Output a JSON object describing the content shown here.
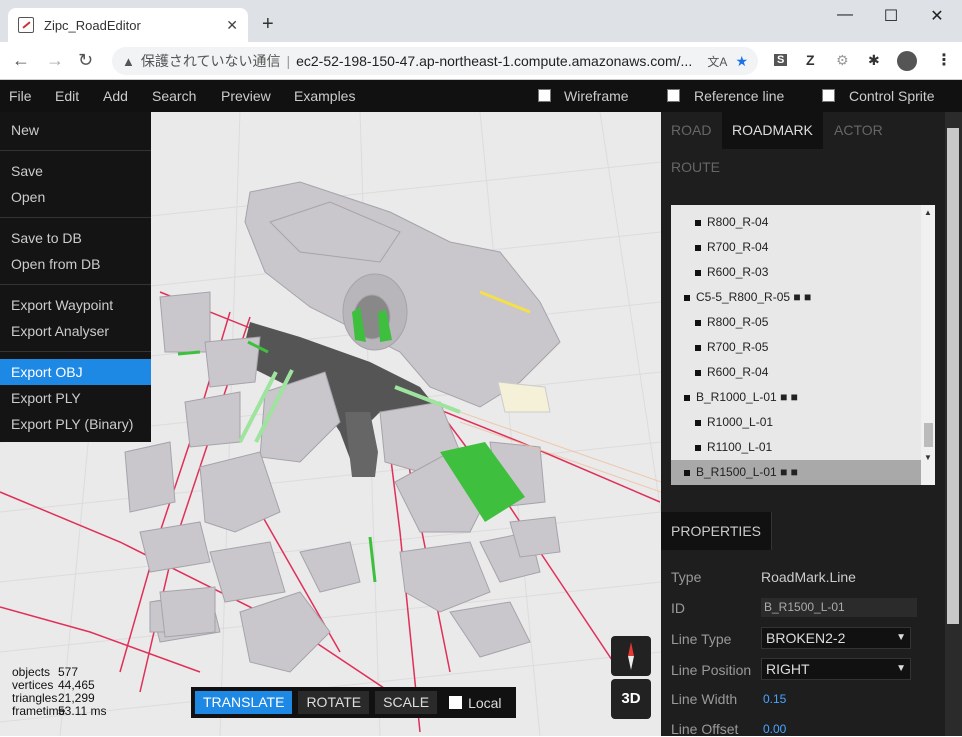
{
  "browser": {
    "tab_title": "Zipc_RoadEditor",
    "tab_close": "✕",
    "new_tab": "+",
    "window_controls": [
      "—",
      "☐",
      "✕"
    ],
    "insecure_label": "保護されていない通信",
    "url": "ec2-52-198-150-47.ap-northeast-1.compute.amazonaws.com/...",
    "nav_icons": [
      "back-icon",
      "forward-icon",
      "reload-icon"
    ],
    "extensions": [
      "S",
      "Z",
      "⚙",
      "✱"
    ]
  },
  "menubar": {
    "items": [
      "File",
      "Edit",
      "Add",
      "Search",
      "Preview",
      "Examples"
    ],
    "toggles": [
      "Wireframe",
      "Reference line",
      "Control Sprite"
    ]
  },
  "file_menu": {
    "groups": [
      [
        "New"
      ],
      [
        "Save",
        "Open"
      ],
      [
        "Save to DB",
        "Open from DB"
      ],
      [
        "Export Waypoint",
        "Export Analyser"
      ],
      [
        "Export OBJ",
        "Export PLY",
        "Export PLY (Binary)"
      ]
    ],
    "active": "Export OBJ"
  },
  "stats": {
    "objects": {
      "label": "objects",
      "value": "577"
    },
    "vertices": {
      "label": "vertices",
      "value": "44,465"
    },
    "triangles": {
      "label": "triangles",
      "value": "21,299"
    },
    "frametime": {
      "label": "frametime",
      "value": "53.11 ms"
    }
  },
  "gizmo": {
    "buttons": [
      "TRANSLATE",
      "ROTATE",
      "SCALE"
    ],
    "active": "TRANSLATE",
    "local_label": "Local"
  },
  "view_button": "3D",
  "panel": {
    "tabs": [
      "ROAD",
      "ROADMARK",
      "ACTOR",
      "ROUTE"
    ],
    "active_tab": "ROADMARK",
    "list": [
      {
        "label": "R800_R-04",
        "depth": 1
      },
      {
        "label": "R700_R-04",
        "depth": 1
      },
      {
        "label": "R600_R-03",
        "depth": 1
      },
      {
        "label": "C5-5_R800_R-05 ■ ■",
        "depth": 0
      },
      {
        "label": "R800_R-05",
        "depth": 1
      },
      {
        "label": "R700_R-05",
        "depth": 1
      },
      {
        "label": "R600_R-04",
        "depth": 1
      },
      {
        "label": "B_R1000_L-01 ■ ■",
        "depth": 0
      },
      {
        "label": "R1000_L-01",
        "depth": 1
      },
      {
        "label": "R1100_L-01",
        "depth": 1
      },
      {
        "label": "B_R1500_L-01 ■ ■",
        "depth": 0,
        "selected": true
      }
    ],
    "properties_tab": "PROPERTIES",
    "properties": {
      "type_label": "Type",
      "type_value": "RoadMark.Line",
      "id_label": "ID",
      "id_value": "B_R1500_L-01",
      "line_type_label": "Line Type",
      "line_type_value": "BROKEN2-2",
      "line_position_label": "Line Position",
      "line_position_value": "RIGHT",
      "line_width_label": "Line Width",
      "line_width_value": "0.15",
      "line_offset_label": "Line Offset",
      "line_offset_value": "0.00"
    }
  }
}
